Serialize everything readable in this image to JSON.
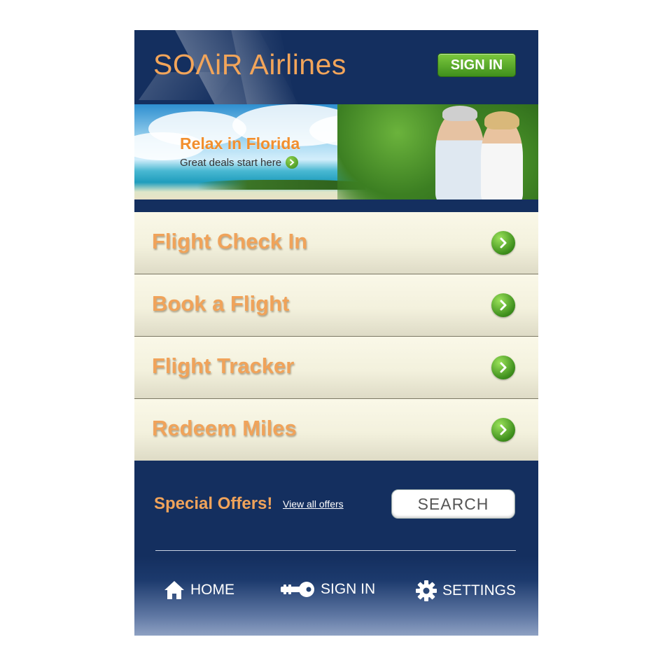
{
  "header": {
    "logo": "SOΛiR Airlines",
    "sign_in_label": "SIGN IN"
  },
  "banner": {
    "title": "Relax in Florida",
    "subtitle": "Great deals start here"
  },
  "menu": {
    "items": [
      {
        "label": "Flight Check In"
      },
      {
        "label": "Book a Flight"
      },
      {
        "label": "Flight Tracker"
      },
      {
        "label": "Redeem Miles"
      }
    ]
  },
  "offers": {
    "title": "Special Offers!",
    "link": "View all offers",
    "search_label": "SEARCH"
  },
  "bottom_nav": {
    "home": "HOME",
    "sign_in": "SIGN IN",
    "settings": "SETTINGS"
  },
  "colors": {
    "navy": "#142f5f",
    "accent_orange": "#f0a35a",
    "green_button": "#4f9b22",
    "menu_bg": "#f3f1dd"
  }
}
